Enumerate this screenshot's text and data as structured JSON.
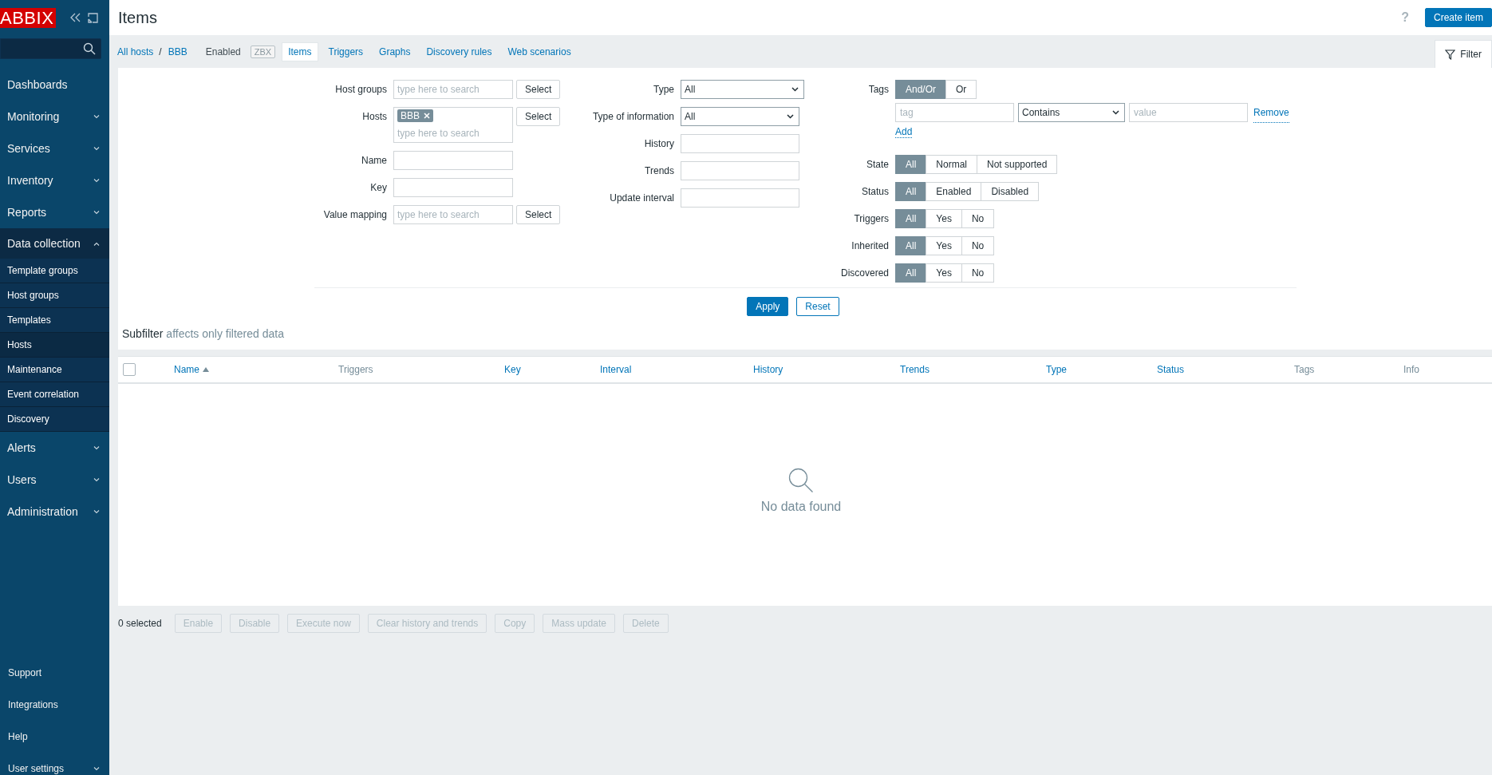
{
  "sidebar": {
    "logo": "ABBIX",
    "menu": [
      {
        "label": "Dashboards",
        "kind": "link"
      },
      {
        "label": "Monitoring",
        "kind": "section",
        "expanded": false
      },
      {
        "label": "Services",
        "kind": "section",
        "expanded": false
      },
      {
        "label": "Inventory",
        "kind": "section",
        "expanded": false
      },
      {
        "label": "Reports",
        "kind": "section",
        "expanded": false
      },
      {
        "label": "Data collection",
        "kind": "section",
        "expanded": true,
        "children": [
          {
            "label": "Template groups",
            "selected": false
          },
          {
            "label": "Host groups",
            "selected": false
          },
          {
            "label": "Templates",
            "selected": false
          },
          {
            "label": "Hosts",
            "selected": true
          },
          {
            "label": "Maintenance",
            "selected": false
          },
          {
            "label": "Event correlation",
            "selected": false
          },
          {
            "label": "Discovery",
            "selected": false
          }
        ]
      },
      {
        "label": "Alerts",
        "kind": "section",
        "expanded": false
      },
      {
        "label": "Users",
        "kind": "section",
        "expanded": false
      },
      {
        "label": "Administration",
        "kind": "section",
        "expanded": false
      }
    ],
    "footer": [
      {
        "label": "Support",
        "kind": "link"
      },
      {
        "label": "Integrations",
        "kind": "link"
      },
      {
        "label": "Help",
        "kind": "link"
      },
      {
        "label": "User settings",
        "kind": "section",
        "expanded": false
      }
    ]
  },
  "header": {
    "title": "Items",
    "help": "?",
    "create_button": "Create item"
  },
  "host_nav": {
    "all_hosts": "All hosts",
    "separator": "/",
    "host": "BBB",
    "status": "Enabled",
    "badges": [
      {
        "label": "ZBX",
        "disabled": true
      }
    ]
  },
  "tabs": [
    {
      "label": "Items",
      "selected": true
    },
    {
      "label": "Triggers",
      "selected": false
    },
    {
      "label": "Graphs",
      "selected": false
    },
    {
      "label": "Discovery rules",
      "selected": false
    },
    {
      "label": "Web scenarios",
      "selected": false
    }
  ],
  "filter_tab": {
    "label": "Filter",
    "expanded": true
  },
  "filter": {
    "left": [
      {
        "label": "Host groups",
        "kind": "multiselect",
        "placeholder": "type here to search",
        "button": "Select"
      },
      {
        "label": "Hosts",
        "kind": "multiselect",
        "chips": [
          "BBB"
        ],
        "placeholder": "type here to search",
        "button": "Select"
      },
      {
        "label": "Name",
        "kind": "text"
      },
      {
        "label": "Key",
        "kind": "text"
      },
      {
        "label": "Value mapping",
        "kind": "multiselect",
        "placeholder": "type here to search",
        "button": "Select"
      }
    ],
    "middle": [
      {
        "label": "Type",
        "kind": "select",
        "value": "All"
      },
      {
        "label": "Type of information",
        "kind": "select",
        "value": "All"
      },
      {
        "label": "History",
        "kind": "text"
      },
      {
        "label": "Trends",
        "kind": "text"
      },
      {
        "label": "Update interval",
        "kind": "text"
      }
    ],
    "tags": {
      "label": "Tags",
      "operators": [
        {
          "label": "And/Or",
          "selected": true
        },
        {
          "label": "Or",
          "selected": false
        }
      ],
      "rows": [
        {
          "tag_placeholder": "tag",
          "operator": "Contains",
          "value_placeholder": "value",
          "remove": "Remove"
        }
      ],
      "add": "Add"
    },
    "radios": [
      {
        "label": "State",
        "options": [
          {
            "label": "All",
            "selected": true
          },
          {
            "label": "Normal",
            "selected": false
          },
          {
            "label": "Not supported",
            "selected": false
          }
        ]
      },
      {
        "label": "Status",
        "options": [
          {
            "label": "All",
            "selected": true
          },
          {
            "label": "Enabled",
            "selected": false
          },
          {
            "label": "Disabled",
            "selected": false
          }
        ]
      },
      {
        "label": "Triggers",
        "options": [
          {
            "label": "All",
            "selected": true
          },
          {
            "label": "Yes",
            "selected": false
          },
          {
            "label": "No",
            "selected": false
          }
        ]
      },
      {
        "label": "Inherited",
        "options": [
          {
            "label": "All",
            "selected": true
          },
          {
            "label": "Yes",
            "selected": false
          },
          {
            "label": "No",
            "selected": false
          }
        ]
      },
      {
        "label": "Discovered",
        "options": [
          {
            "label": "All",
            "selected": true
          },
          {
            "label": "Yes",
            "selected": false
          },
          {
            "label": "No",
            "selected": false
          }
        ]
      }
    ],
    "apply": "Apply",
    "reset": "Reset"
  },
  "subfilter": {
    "label": "Subfilter",
    "note": "affects only filtered data"
  },
  "table": {
    "select_all": {
      "checked": false
    },
    "columns": [
      {
        "label": "Name",
        "sortable": true,
        "sorted_ascending": true
      },
      {
        "label": "Triggers",
        "sortable": false
      },
      {
        "label": "Key",
        "sortable": true
      },
      {
        "label": "Interval",
        "sortable": true
      },
      {
        "label": "History",
        "sortable": true
      },
      {
        "label": "Trends",
        "sortable": true
      },
      {
        "label": "Type",
        "sortable": true
      },
      {
        "label": "Status",
        "sortable": true
      },
      {
        "label": "Tags",
        "sortable": false
      },
      {
        "label": "Info",
        "sortable": false
      }
    ],
    "empty": "No data found"
  },
  "actions": {
    "selected": "0 selected",
    "buttons": [
      {
        "label": "Enable",
        "disabled": true
      },
      {
        "label": "Disable",
        "disabled": true
      },
      {
        "label": "Execute now",
        "disabled": true
      },
      {
        "label": "Clear history and trends",
        "disabled": true
      },
      {
        "label": "Copy",
        "disabled": true
      },
      {
        "label": "Mass update",
        "disabled": true
      },
      {
        "label": "Delete",
        "disabled": true
      }
    ]
  }
}
